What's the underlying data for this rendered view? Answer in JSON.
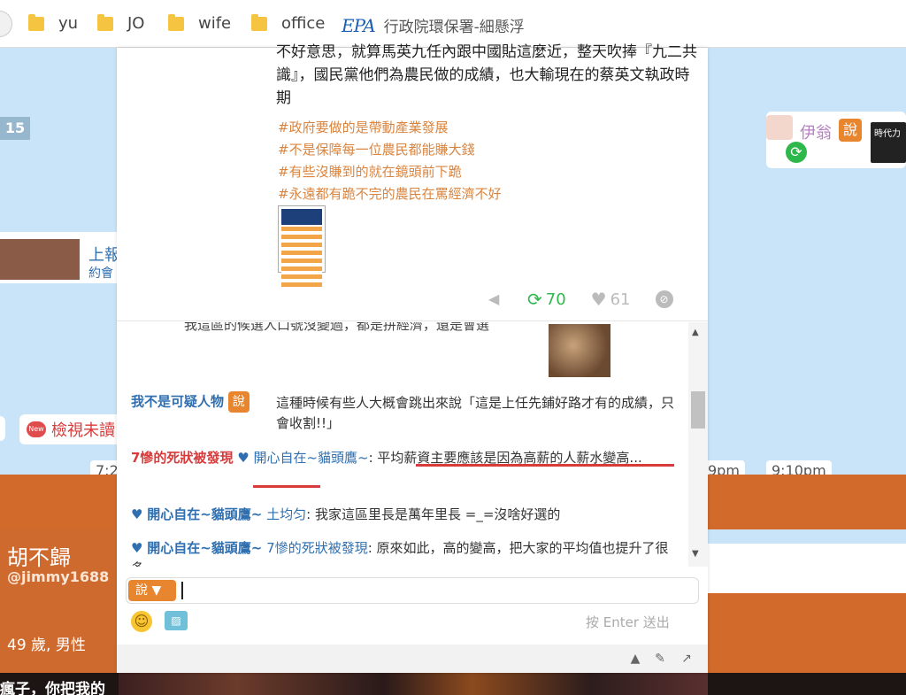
{
  "bookmarks": {
    "items": [
      {
        "label": "yu"
      },
      {
        "label": "JO"
      },
      {
        "label": "wife"
      },
      {
        "label": "office"
      }
    ],
    "epa_label": "行政院環保署-細懸浮"
  },
  "background": {
    "left_number": "15",
    "left_link_line1": "上報",
    "left_link_line2": "約會",
    "unread_label": "檢視未讀",
    "new_badge": "New",
    "right_name": "伊翁",
    "say_label": "說",
    "promo_text": "時代力",
    "times": [
      "7:2",
      "9pm",
      "9:10pm"
    ],
    "profile": {
      "name": "胡不歸",
      "handle": "@jimmy1688",
      "age_gender": "49 歲, 男性"
    },
    "bottom_text": "瘋子，你把我的"
  },
  "post": {
    "text": "不好意思，就算馬英九任內跟中國貼這麼近，整天吹捧『九二共識』，國民黨他們為農民做的成績，也大輸現在的蔡英文執政時期",
    "hashtags": [
      "#政府要做的是帶動產業發展",
      "#不是保障每一位農民都能賺大錢",
      "#有些沒賺到的就在鏡頭前下跪",
      "#永遠都有跪不完的農民在罵經濟不好"
    ],
    "repost_count": "70",
    "like_count": "61"
  },
  "chat": {
    "partial_top": "我這區的候選人口號沒變過，都是拼經濟，還是會選",
    "messages": [
      {
        "sender": "我不是可疑人物",
        "badge": "說",
        "text": "這種時候有些人大概會跳出來說「這是上任先鋪好路才有的成績，只會收割!!」"
      },
      {
        "sender": "7慘的死狀被發現",
        "heart": "♥",
        "target": "開心自在~貓頭鷹~",
        "text": ": 平均薪資主要應該是因為高薪的人薪水變高..."
      },
      {
        "sender": "開心自在~貓頭鷹~",
        "heart": "♥",
        "target": "土均匀",
        "text": ": 我家這區里長是萬年里長 =_=沒啥好選的"
      },
      {
        "sender": "開心自在~貓頭鷹~",
        "heart": "♥",
        "target": "7慘的死狀被發現",
        "text": ": 原來如此，高的變高，把大家的平均值也提升了很多"
      }
    ]
  },
  "input": {
    "say_label": "說",
    "hint": "按 Enter 送出"
  }
}
